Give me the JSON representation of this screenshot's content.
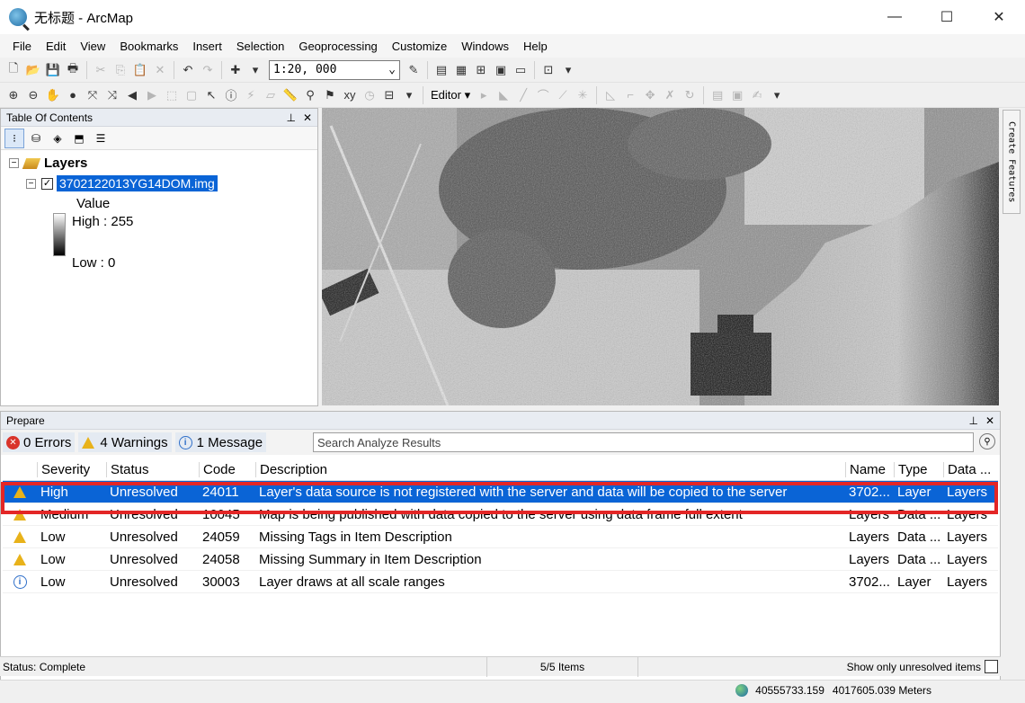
{
  "window": {
    "title": "无标题 - ArcMap",
    "minimize": "—",
    "maximize": "☐",
    "close": "✕"
  },
  "menu": [
    "File",
    "Edit",
    "View",
    "Bookmarks",
    "Insert",
    "Selection",
    "Geoprocessing",
    "Customize",
    "Windows",
    "Help"
  ],
  "toolbar": {
    "scale": "1:20, 000",
    "editor_label": "Editor"
  },
  "toc": {
    "title": "Table Of Contents",
    "root_label": "Layers",
    "layer_name": "3702122013YG14DOM.img",
    "value_label": "Value",
    "high_label": "High : 255",
    "low_label": "Low : 0",
    "checked": true
  },
  "side_tab": {
    "label": "Create Features"
  },
  "prepare": {
    "title": "Prepare",
    "tabs": {
      "errors": "0 Errors",
      "warnings": "4 Warnings",
      "messages": "1 Message"
    },
    "search_placeholder": "Search Analyze Results",
    "columns": {
      "severity": "Severity",
      "status": "Status",
      "code": "Code",
      "description": "Description",
      "name": "Name",
      "type": "Type",
      "data": "Data ..."
    },
    "rows": [
      {
        "icon": "warning-icon",
        "severity": "High",
        "status": "Unresolved",
        "code": "24011",
        "description": "Layer's data source is not registered with the server and data will be copied to the server",
        "name": "3702...",
        "type": "Layer",
        "data": "Layers"
      },
      {
        "icon": "warning-icon",
        "severity": "Medium",
        "status": "Unresolved",
        "code": "10045",
        "description": "Map is being published with data copied to the server using data frame full extent",
        "name": "Layers",
        "type": "Data ...",
        "data": "Layers"
      },
      {
        "icon": "warning-icon",
        "severity": "Low",
        "status": "Unresolved",
        "code": "24059",
        "description": "Missing Tags in Item Description",
        "name": "Layers",
        "type": "Data ...",
        "data": "Layers"
      },
      {
        "icon": "warning-icon",
        "severity": "Low",
        "status": "Unresolved",
        "code": "24058",
        "description": "Missing Summary in Item Description",
        "name": "Layers",
        "type": "Data ...",
        "data": "Layers"
      },
      {
        "icon": "info-icon",
        "severity": "Low",
        "status": "Unresolved",
        "code": "30003",
        "description": "Layer draws at all scale ranges",
        "name": "3702...",
        "type": "Layer",
        "data": "Layers"
      }
    ]
  },
  "status": {
    "state": "Status: Complete",
    "items": "5/5 Items",
    "unresolved_label": "Show only unresolved items"
  },
  "coordinates": {
    "x": "40555733.159",
    "y": "4017605.039 Meters"
  },
  "colors": {
    "selection_blue": "#0a64d6",
    "highlight_red": "#e32626",
    "warning_yellow": "#e8b21a"
  }
}
